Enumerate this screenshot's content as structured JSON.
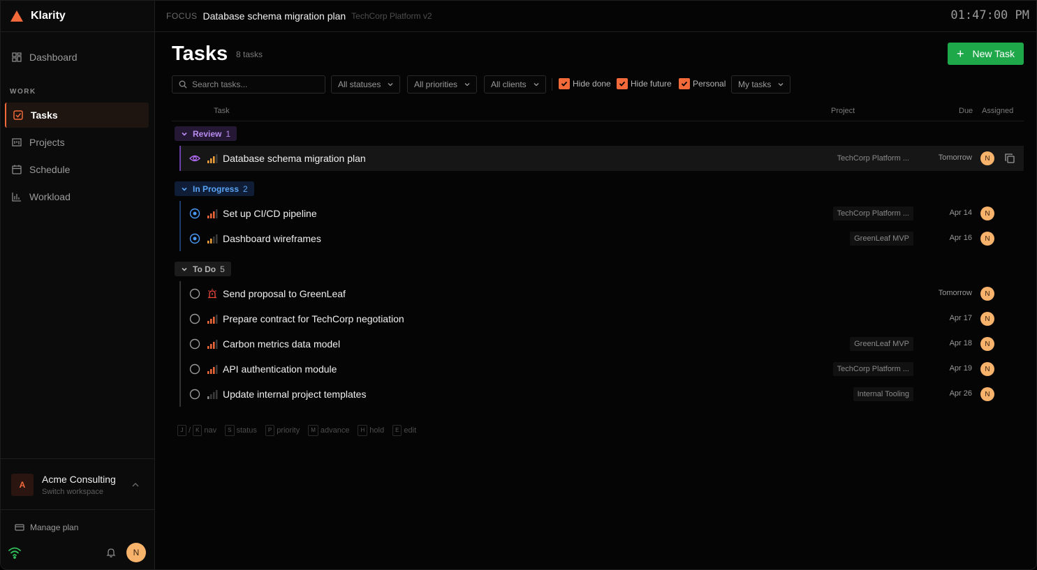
{
  "app": {
    "name": "Klarity",
    "accent": "#f26a3a"
  },
  "sidebar": {
    "dashboard": "Dashboard",
    "section_label": "WORK",
    "items": [
      {
        "label": "Tasks",
        "icon": "checkbox-icon",
        "active": true
      },
      {
        "label": "Projects",
        "icon": "projects-icon"
      },
      {
        "label": "Schedule",
        "icon": "calendar-icon"
      },
      {
        "label": "Workload",
        "icon": "bar-chart-icon"
      }
    ],
    "workspace": {
      "initial": "A",
      "name": "Acme Consulting",
      "subtitle": "Switch workspace"
    },
    "manage_plan": "Manage plan",
    "user_initial": "N"
  },
  "header": {
    "focus_label": "FOCUS",
    "focus_title": "Database schema migration plan",
    "focus_project": "TechCorp Platform v2",
    "clock": "01:47:00 PM"
  },
  "main": {
    "title": "Tasks",
    "count": "8 tasks",
    "new_task": "New Task",
    "search_placeholder": "Search tasks...",
    "filters": {
      "status": "All statuses",
      "priority": "All priorities",
      "clients": "All clients",
      "hide_done": "Hide done",
      "hide_future": "Hide future",
      "personal": "Personal",
      "assignee": "My tasks"
    },
    "columns": {
      "task": "Task",
      "project": "Project",
      "due": "Due",
      "assigned": "Assigned"
    },
    "groups": [
      {
        "name": "Review",
        "count": "1",
        "tasks": [
          {
            "title": "Database schema migration plan",
            "project": "TechCorp Platform ...",
            "due": "Tomorrow",
            "assignee": "N"
          }
        ]
      },
      {
        "name": "In Progress",
        "count": "2",
        "tasks": [
          {
            "title": "Set up CI/CD pipeline",
            "project": "TechCorp Platform ...",
            "due": "Apr 14",
            "assignee": "N"
          },
          {
            "title": "Dashboard wireframes",
            "project": "GreenLeaf MVP",
            "due": "Apr 16",
            "assignee": "N"
          }
        ]
      },
      {
        "name": "To Do",
        "count": "5",
        "tasks": [
          {
            "title": "Send proposal to GreenLeaf",
            "project": "",
            "due": "Tomorrow",
            "assignee": "N"
          },
          {
            "title": "Prepare contract for TechCorp negotiation",
            "project": "",
            "due": "Apr 17",
            "assignee": "N"
          },
          {
            "title": "Carbon metrics data model",
            "project": "GreenLeaf MVP",
            "due": "Apr 18",
            "assignee": "N"
          },
          {
            "title": "API authentication module",
            "project": "TechCorp Platform ...",
            "due": "Apr 19",
            "assignee": "N"
          },
          {
            "title": "Update internal project templates",
            "project": "Internal Tooling",
            "due": "Apr 26",
            "assignee": "N"
          }
        ]
      }
    ],
    "shortcuts": {
      "j": "J",
      "k": "K",
      "nav": "nav",
      "s": "S",
      "status": "status",
      "p": "P",
      "priority": "priority",
      "m": "M",
      "advance": "advance",
      "h": "H",
      "hold": "hold",
      "e": "E",
      "edit": "edit"
    }
  }
}
